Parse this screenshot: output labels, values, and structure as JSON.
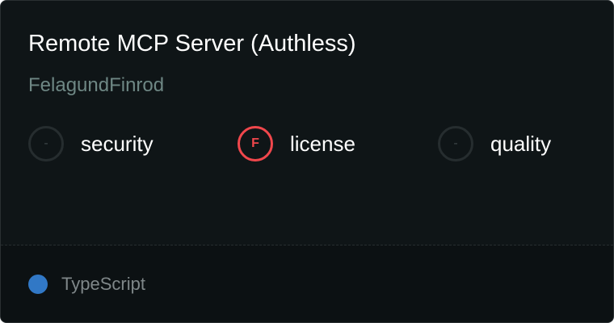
{
  "server": {
    "title": "Remote MCP Server (Authless)",
    "author": "FelagundFinrod"
  },
  "scores": [
    {
      "name": "security",
      "grade": "-",
      "status": "none"
    },
    {
      "name": "license",
      "grade": "F",
      "status": "fail",
      "color": "#f0474c"
    },
    {
      "name": "quality",
      "grade": "-",
      "status": "none"
    }
  ],
  "language": {
    "name": "TypeScript",
    "color": "#3178c6"
  }
}
